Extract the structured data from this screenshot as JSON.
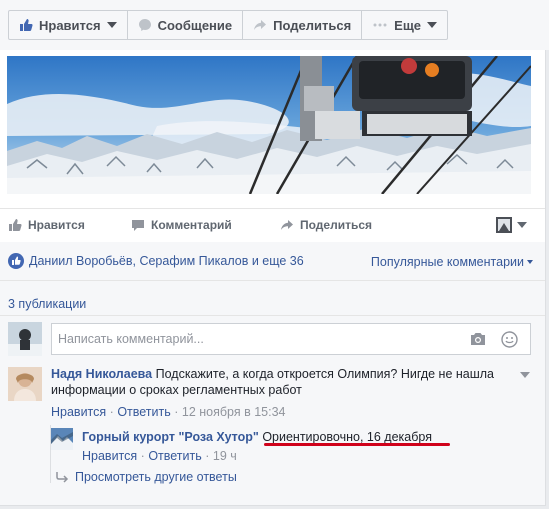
{
  "toolbar": {
    "like_label": "Нравится",
    "message_label": "Сообщение",
    "share_label": "Поделиться",
    "more_label": "Еще"
  },
  "post_actions": {
    "like": "Нравится",
    "comment": "Комментарий",
    "share": "Поделиться"
  },
  "likes": {
    "text": "Даниил Воробьёв, Серафим Пикалов и еще 36",
    "sort_label": "Популярные комментарии"
  },
  "publications_label": "3 публикации",
  "comment_input": {
    "placeholder": "Написать комментарий..."
  },
  "comments": [
    {
      "author": "Надя Николаева",
      "text": "Подскажите, а когда откроется Олимпия? Нигде не нашла информации о сроках регламентных работ",
      "like": "Нравится",
      "reply": "Ответить",
      "time": "12 ноября в 15:34"
    }
  ],
  "reply": {
    "author": "Горный курорт \"Роза Хутор\"",
    "text": "Ориентировочно, 16 декабря",
    "like": "Нравится",
    "reply": "Ответить",
    "time": "19 ч"
  },
  "more_replies": "Просмотреть другие ответы",
  "meta_separator": "·",
  "colors": {
    "link": "#365899",
    "highlight_underline": "#d0021b"
  }
}
